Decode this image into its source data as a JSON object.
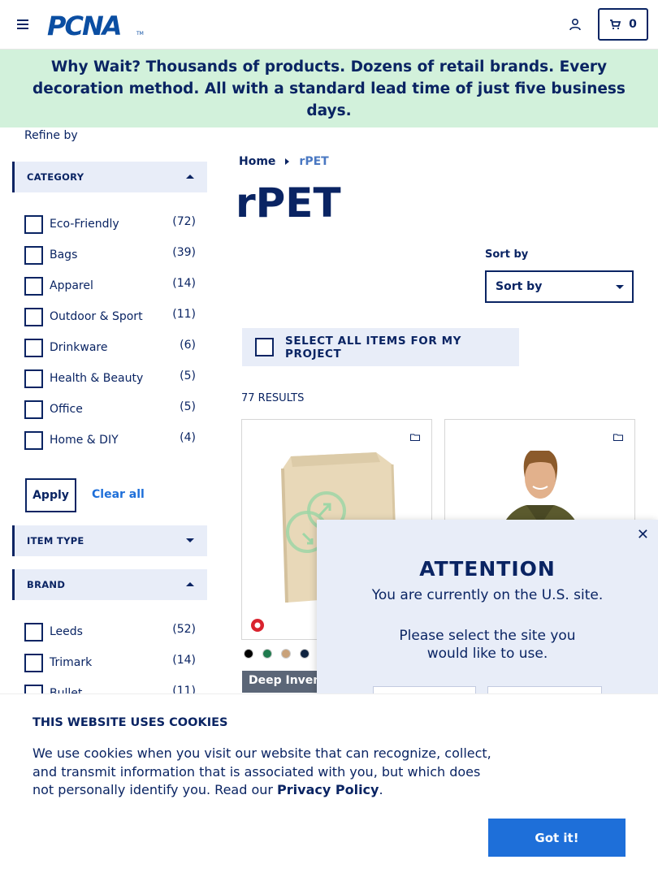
{
  "header": {
    "logo_text": "PCNA",
    "logo_tm": "TM",
    "cart_count": "0"
  },
  "promo": {
    "text": "Why Wait? Thousands of products. Dozens of retail brands. Every decoration method. All with a standard lead time of just five business days."
  },
  "sidebar": {
    "refine_label": "Refine by",
    "category": {
      "title": "CATEGORY",
      "items": [
        {
          "label": "Eco-Friendly",
          "count": "(72)"
        },
        {
          "label": "Bags",
          "count": "(39)"
        },
        {
          "label": "Apparel",
          "count": "(14)"
        },
        {
          "label": "Outdoor & Sport",
          "count": "(11)"
        },
        {
          "label": "Drinkware",
          "count": "(6)"
        },
        {
          "label": "Health & Beauty",
          "count": "(5)"
        },
        {
          "label": "Office",
          "count": "(5)"
        },
        {
          "label": "Home & DIY",
          "count": "(4)"
        }
      ]
    },
    "apply_label": "Apply",
    "clear_label": "Clear all",
    "item_type": {
      "title": "ITEM TYPE"
    },
    "brand": {
      "title": "BRAND",
      "items": [
        {
          "label": "Leeds",
          "count": "(52)"
        },
        {
          "label": "Trimark",
          "count": "(14)"
        },
        {
          "label": "Bullet",
          "count": "(11)"
        }
      ]
    }
  },
  "main": {
    "breadcrumb": {
      "home": "Home",
      "current": "rPET"
    },
    "title": "rPET",
    "sort": {
      "label": "Sort by",
      "value": "Sort by"
    },
    "select_all_label": "SELECT ALL ITEMS FOR MY PROJECT",
    "results_text": "77 RESULTS",
    "product1": {
      "swatch_colors": [
        "#000000",
        "#1f7a4d",
        "#c9a27a",
        "#0f2340"
      ],
      "badge": "Deep Inventory"
    }
  },
  "modal": {
    "title": "ATTENTION",
    "line1": "You are currently on the U.S. site.",
    "line2": "Please select the site you would like to use.",
    "close_glyph": "✕"
  },
  "cookie": {
    "title": "THIS WEBSITE USES COOKIES",
    "text_before": "We use cookies when you visit our website that can recognize, collect, and transmit information that is associated with you, but which does not personally identify you. Read our ",
    "link": "Privacy Policy",
    "text_after": ".",
    "button": "Got it!"
  }
}
